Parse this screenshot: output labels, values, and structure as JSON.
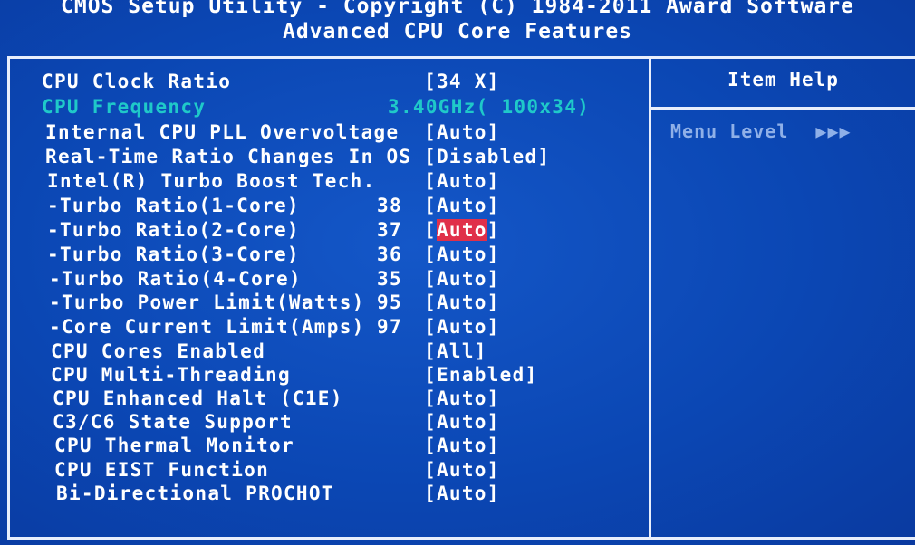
{
  "header": {
    "title": "CMOS Setup Utility - Copyright (C) 1984-2011 Award Software",
    "subtitle": "Advanced CPU Core Features"
  },
  "help": {
    "title": "Item Help",
    "menu_level_label": "Menu Level",
    "menu_level_arrows": "▶▶▶"
  },
  "settings": [
    {
      "label": "CPU Clock Ratio",
      "num": "",
      "value_pre": "[",
      "value": "34 X",
      "value_post": "]"
    },
    {
      "label": "CPU Frequency",
      "num": "",
      "value_pre": "",
      "value": "3.40GHz( 100x34)",
      "value_post": ""
    },
    {
      "label": "Internal CPU PLL Overvoltage",
      "num": "",
      "value_pre": "[",
      "value": "Auto",
      "value_post": "]"
    },
    {
      "label": "Real-Time Ratio Changes In OS",
      "num": "",
      "value_pre": "[",
      "value": "Disabled",
      "value_post": "]"
    },
    {
      "label": "Intel(R) Turbo Boost Tech.",
      "num": "",
      "value_pre": "[",
      "value": "Auto",
      "value_post": "]"
    },
    {
      "label": "-Turbo Ratio(1-Core)",
      "num": "38",
      "value_pre": "[",
      "value": "Auto",
      "value_post": "]"
    },
    {
      "label": "-Turbo Ratio(2-Core)",
      "num": "37",
      "value_pre": "[",
      "value": "Auto",
      "value_post": "]"
    },
    {
      "label": "-Turbo Ratio(3-Core)",
      "num": "36",
      "value_pre": "[",
      "value": "Auto",
      "value_post": "]"
    },
    {
      "label": "-Turbo Ratio(4-Core)",
      "num": "35",
      "value_pre": "[",
      "value": "Auto",
      "value_post": "]"
    },
    {
      "label": "-Turbo Power Limit(Watts)",
      "num": "95",
      "value_pre": "[",
      "value": "Auto",
      "value_post": "]"
    },
    {
      "label": "-Core Current Limit(Amps)",
      "num": "97",
      "value_pre": "[",
      "value": "Auto",
      "value_post": "]"
    },
    {
      "label": "CPU Cores Enabled",
      "num": "",
      "value_pre": "[",
      "value": "All",
      "value_post": "]"
    },
    {
      "label": "CPU Multi-Threading",
      "num": "",
      "value_pre": "[",
      "value": "Enabled",
      "value_post": "]"
    },
    {
      "label": "CPU Enhanced Halt (C1E)",
      "num": "",
      "value_pre": "[",
      "value": "Auto",
      "value_post": "]"
    },
    {
      "label": "C3/C6 State Support",
      "num": "",
      "value_pre": "[",
      "value": "Auto",
      "value_post": "]"
    },
    {
      "label": "CPU Thermal Monitor",
      "num": "",
      "value_pre": "[",
      "value": "Auto",
      "value_post": "]"
    },
    {
      "label": "CPU EIST Function",
      "num": "",
      "value_pre": "[",
      "value": "Auto",
      "value_post": "]"
    },
    {
      "label": "Bi-Directional PROCHOT",
      "num": "",
      "value_pre": "[",
      "value": "Auto",
      "value_post": "]"
    }
  ],
  "colors": {
    "background": "#0b47b4",
    "text": "#ffffff",
    "disabled_text": "#1fc9c9",
    "highlight": "#e0304a",
    "border": "#e8eefc",
    "help_dim": "#8fb0e8"
  }
}
